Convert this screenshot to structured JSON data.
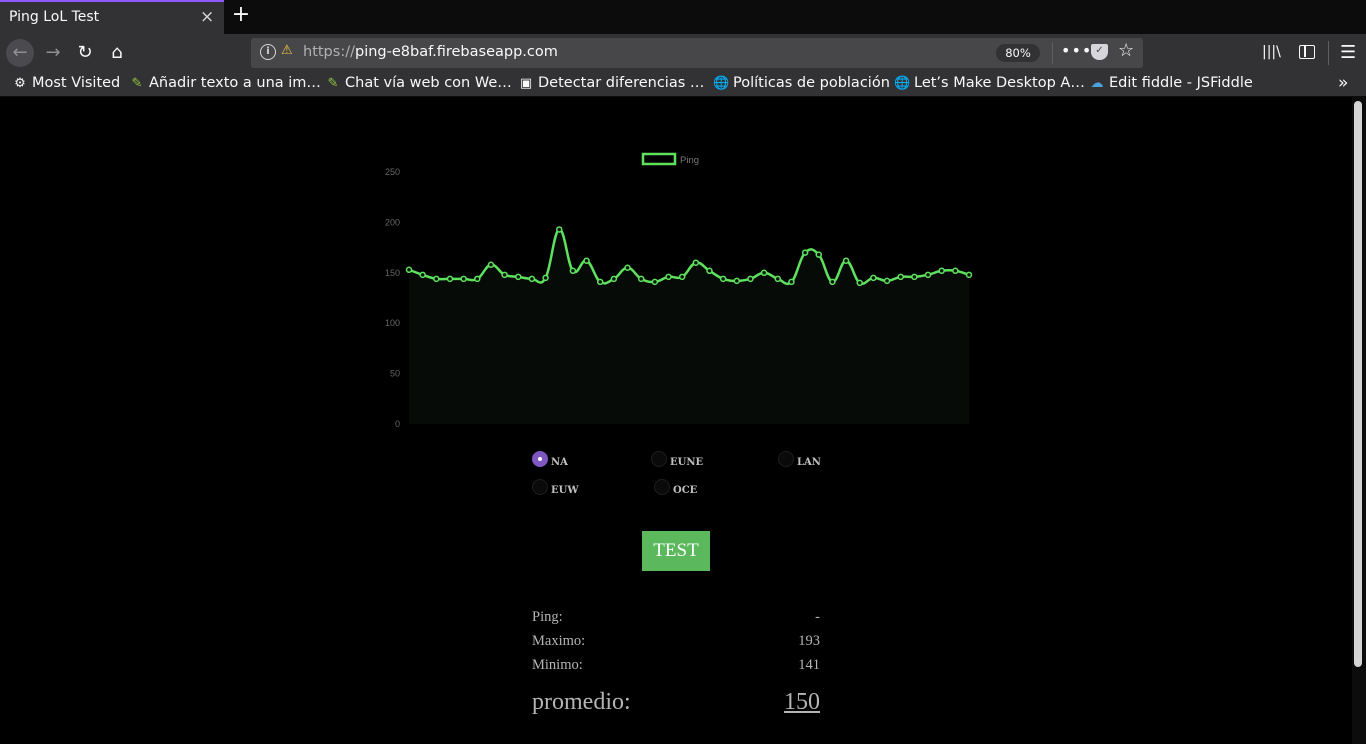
{
  "browser": {
    "tab_title": "Ping LoL Test",
    "tab_close": "×",
    "new_tab": "+",
    "url_scheme": "https://",
    "url_host": "ping-e8baf.firebaseapp.com",
    "zoom": "80%",
    "more": "•••",
    "icons": {
      "back": "←",
      "forward": "→",
      "reload": "↻",
      "home": "⌂",
      "star": "☆",
      "menu": "☰",
      "library": "|||\\",
      "chevron": "»"
    }
  },
  "bookmarks": [
    {
      "label": "Most Visited",
      "icon": "⚙"
    },
    {
      "label": "Añadir texto a una im…",
      "icon": "✎"
    },
    {
      "label": "Chat vía web con We…",
      "icon": "✎"
    },
    {
      "label": "Detectar diferencias …",
      "icon": "▣"
    },
    {
      "label": "Políticas de población",
      "icon": "🌐"
    },
    {
      "label": "Let’s Make Desktop A…",
      "icon": "🌐"
    },
    {
      "label": "Edit fiddle - JSFiddle",
      "icon": "☁"
    }
  ],
  "chart_data": {
    "type": "area",
    "series": [
      {
        "name": "Ping",
        "values": [
          153,
          148,
          144,
          144,
          144,
          144,
          158,
          148,
          146,
          144,
          145,
          193,
          152,
          162,
          141,
          144,
          155,
          144,
          141,
          146,
          146,
          160,
          152,
          144,
          142,
          144,
          150,
          144,
          141,
          170,
          168,
          141,
          162,
          140,
          145,
          142,
          146,
          146,
          148,
          152,
          152,
          148
        ]
      }
    ],
    "ylim": [
      0,
      250
    ],
    "yticks": [
      0,
      50,
      100,
      150,
      200,
      250
    ],
    "legend": "top",
    "line_color": "#5ee25e",
    "fill_color": "#070b07",
    "grid": false
  },
  "regions": [
    {
      "label": "NA",
      "checked": true
    },
    {
      "label": "EUNE",
      "checked": false
    },
    {
      "label": "LAN",
      "checked": false
    },
    {
      "label": "EUW",
      "checked": false
    },
    {
      "label": "OCE",
      "checked": false
    }
  ],
  "test_button": "TEST",
  "stats": {
    "ping_label": "Ping:",
    "ping_value": "-",
    "max_label": "Maximo:",
    "max_value": "193",
    "min_label": "Minimo:",
    "min_value": "141",
    "avg_label": "promedio:",
    "avg_value": "150"
  },
  "colors": {
    "accent": "#9059ff",
    "button": "#5cb85c",
    "radio_checked": "#7e57c2"
  }
}
